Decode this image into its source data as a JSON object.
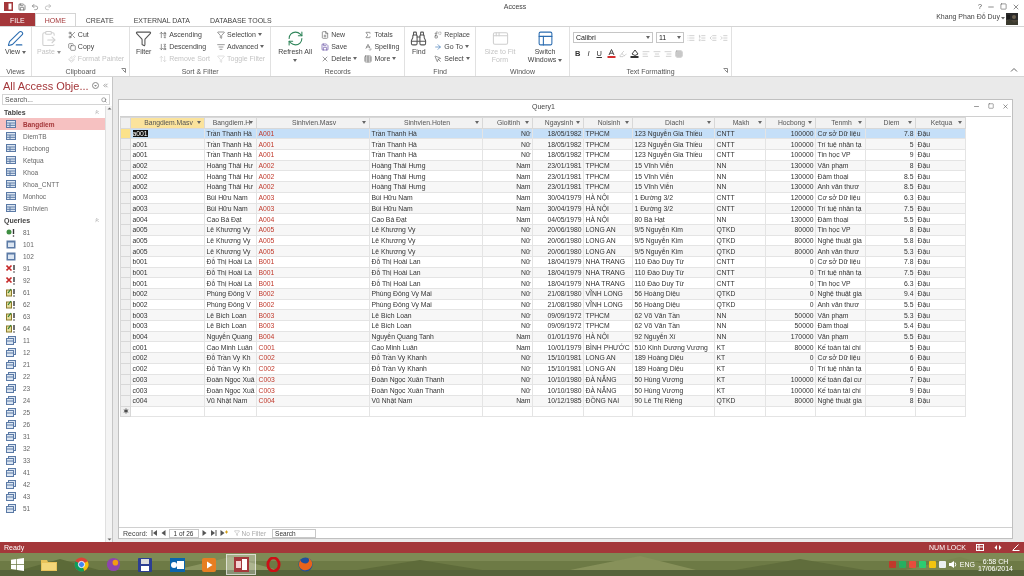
{
  "app": {
    "title": "Access",
    "help": "?",
    "user": "Khang Phan Đỗ Duy"
  },
  "ribbon_tabs": [
    {
      "label": "FILE",
      "kind": "file",
      "selected": false
    },
    {
      "label": "HOME",
      "kind": "tab",
      "selected": true
    },
    {
      "label": "CREATE",
      "kind": "tab",
      "selected": false
    },
    {
      "label": "EXTERNAL DATA",
      "kind": "tab",
      "selected": false
    },
    {
      "label": "DATABASE TOOLS",
      "kind": "tab",
      "selected": false
    }
  ],
  "ribbon_groups": [
    {
      "label": "Views",
      "buttons": [
        {
          "label": "View",
          "kind": "large",
          "dropdown": true,
          "disabled": false
        }
      ]
    },
    {
      "label": "Clipboard",
      "launcher": true,
      "buttons": [
        {
          "label": "Paste",
          "kind": "large",
          "dropdown": true,
          "disabled": true
        },
        {
          "label": "Cut",
          "kind": "small",
          "disabled": false
        },
        {
          "label": "Copy",
          "kind": "small",
          "disabled": false
        },
        {
          "label": "Format Painter",
          "kind": "small",
          "disabled": true
        }
      ]
    },
    {
      "label": "Sort & Filter",
      "buttons": [
        {
          "label": "Filter",
          "kind": "large",
          "disabled": false
        },
        {
          "label": "Ascending",
          "kind": "small",
          "disabled": false
        },
        {
          "label": "Descending",
          "kind": "small",
          "disabled": false
        },
        {
          "label": "Remove Sort",
          "kind": "small",
          "disabled": true
        },
        {
          "label": "Selection",
          "kind": "small",
          "dropdown": true,
          "disabled": false
        },
        {
          "label": "Advanced",
          "kind": "small",
          "dropdown": true,
          "disabled": false
        },
        {
          "label": "Toggle Filter",
          "kind": "small",
          "disabled": true
        }
      ]
    },
    {
      "label": "Records",
      "buttons": [
        {
          "label": "Refresh All",
          "kind": "large",
          "dropdown": true,
          "disabled": false
        },
        {
          "label": "New",
          "kind": "small",
          "disabled": false
        },
        {
          "label": "Save",
          "kind": "small",
          "disabled": false
        },
        {
          "label": "Delete",
          "kind": "small",
          "dropdown": true,
          "disabled": false
        },
        {
          "label": "Totals",
          "kind": "small",
          "disabled": false
        },
        {
          "label": "Spelling",
          "kind": "small",
          "disabled": false
        },
        {
          "label": "More",
          "kind": "small",
          "dropdown": true,
          "disabled": false
        }
      ]
    },
    {
      "label": "Find",
      "buttons": [
        {
          "label": "Find",
          "kind": "large",
          "disabled": false
        },
        {
          "label": "Replace",
          "kind": "small",
          "disabled": false
        },
        {
          "label": "Go To",
          "kind": "small",
          "dropdown": true,
          "disabled": false
        },
        {
          "label": "Select",
          "kind": "small",
          "dropdown": true,
          "disabled": false
        }
      ]
    },
    {
      "label": "Window",
      "buttons": [
        {
          "label": "Size to Fit Form",
          "kind": "large",
          "disabled": true
        },
        {
          "label": "Switch Windows",
          "kind": "large",
          "dropdown": true,
          "disabled": false
        }
      ]
    },
    {
      "label": "Text Formatting",
      "launcher": true,
      "buttons": [
        {
          "label": "Calibri",
          "kind": "font",
          "dropdown": true
        },
        {
          "label": "11",
          "kind": "size",
          "dropdown": true
        },
        {
          "label": "B",
          "kind": "format"
        },
        {
          "label": "I",
          "kind": "format"
        },
        {
          "label": "U",
          "kind": "format"
        }
      ]
    }
  ],
  "nav": {
    "title": "All Access Obje...",
    "search_placeholder": "Search...",
    "sections": [
      {
        "label": "Tables",
        "items": [
          {
            "label": "Bangdiem",
            "kind": "table",
            "selected": true
          },
          {
            "label": "DiemTB",
            "kind": "table",
            "selected": false
          },
          {
            "label": "Hocbong",
            "kind": "table",
            "selected": false
          },
          {
            "label": "Ketqua",
            "kind": "table",
            "selected": false
          },
          {
            "label": "Khoa",
            "kind": "table",
            "selected": false
          },
          {
            "label": "Khoa_CNTT",
            "kind": "table",
            "selected": false
          },
          {
            "label": "Monhoc",
            "kind": "table",
            "selected": false
          },
          {
            "label": "Sinhvien",
            "kind": "table",
            "selected": false
          }
        ]
      },
      {
        "label": "Queries",
        "items": [
          {
            "label": "81",
            "kind": "crosstab",
            "selected": false
          },
          {
            "label": "101",
            "kind": "maketable",
            "selected": false
          },
          {
            "label": "102",
            "kind": "maketable",
            "selected": false
          },
          {
            "label": "91",
            "kind": "delete",
            "selected": false
          },
          {
            "label": "92",
            "kind": "delete",
            "selected": false
          },
          {
            "label": "61",
            "kind": "update",
            "selected": false
          },
          {
            "label": "62",
            "kind": "update",
            "selected": false
          },
          {
            "label": "63",
            "kind": "update",
            "selected": false
          },
          {
            "label": "64",
            "kind": "update",
            "selected": false
          },
          {
            "label": "11",
            "kind": "select",
            "selected": false
          },
          {
            "label": "12",
            "kind": "select",
            "selected": false
          },
          {
            "label": "21",
            "kind": "select",
            "selected": false
          },
          {
            "label": "22",
            "kind": "select",
            "selected": false
          },
          {
            "label": "23",
            "kind": "select",
            "selected": false
          },
          {
            "label": "24",
            "kind": "select",
            "selected": false
          },
          {
            "label": "25",
            "kind": "select",
            "selected": false
          },
          {
            "label": "26",
            "kind": "select",
            "selected": false
          },
          {
            "label": "31",
            "kind": "select",
            "selected": false
          },
          {
            "label": "32",
            "kind": "select",
            "selected": false
          },
          {
            "label": "33",
            "kind": "select",
            "selected": false
          },
          {
            "label": "41",
            "kind": "select",
            "selected": false
          },
          {
            "label": "42",
            "kind": "select",
            "selected": false
          },
          {
            "label": "43",
            "kind": "select",
            "selected": false
          },
          {
            "label": "51",
            "kind": "select",
            "selected": false
          }
        ]
      }
    ]
  },
  "datasheet": {
    "title": "Query1",
    "columns": [
      {
        "label": "Bangdiem.Masv",
        "selected": true
      },
      {
        "label": "Bangdiem.H",
        "selected": false
      },
      {
        "label": "Sinhvien.Masv",
        "selected": false
      },
      {
        "label": "Sinhvien.Hoten",
        "selected": false
      },
      {
        "label": "Gioitinh",
        "selected": false
      },
      {
        "label": "Ngaysinh",
        "selected": false
      },
      {
        "label": "Noisinh",
        "selected": false
      },
      {
        "label": "Diachi",
        "selected": false
      },
      {
        "label": "Makh",
        "selected": false
      },
      {
        "label": "Hocbong",
        "selected": false
      },
      {
        "label": "Tenmh",
        "selected": false
      },
      {
        "label": "Diem",
        "selected": false
      },
      {
        "label": "Ketqua",
        "selected": false
      }
    ],
    "rows": [
      {
        "selected": true,
        "cells": [
          "a001",
          "Trần Thanh Hà",
          "A001",
          "Trần Thanh Hà",
          "Nữ",
          "18/05/1982",
          "TPHCM",
          "123 Nguyễn Gia Thiều",
          "CNTT",
          "100000",
          "Cơ sở Dữ liệu",
          "7.8",
          "Đậu"
        ]
      },
      {
        "selected": false,
        "cells": [
          "a001",
          "Trần Thanh Hà",
          "A001",
          "Trần Thanh Hà",
          "Nữ",
          "18/05/1982",
          "TPHCM",
          "123 Nguyễn Gia Thiều",
          "CNTT",
          "100000",
          "Trí tuệ nhân tạ",
          "5",
          "Đậu"
        ]
      },
      {
        "selected": false,
        "cells": [
          "a001",
          "Trần Thanh Hà",
          "A001",
          "Trần Thanh Hà",
          "Nữ",
          "18/05/1982",
          "TPHCM",
          "123 Nguyễn Gia Thiều",
          "CNTT",
          "100000",
          "Tin học VP",
          "9",
          "Đậu"
        ]
      },
      {
        "selected": false,
        "cells": [
          "a002",
          "Hoàng Thái Hư",
          "A002",
          "Hoàng Thái Hưng",
          "Nam",
          "23/01/1981",
          "TPHCM",
          "15 Vĩnh Viễn",
          "NN",
          "130000",
          "Văn phạm",
          "8",
          "Đậu"
        ]
      },
      {
        "selected": false,
        "cells": [
          "a002",
          "Hoàng Thái Hư",
          "A002",
          "Hoàng Thái Hưng",
          "Nam",
          "23/01/1981",
          "TPHCM",
          "15 Vĩnh Viễn",
          "NN",
          "130000",
          "Đàm thoại",
          "8.5",
          "Đậu"
        ]
      },
      {
        "selected": false,
        "cells": [
          "a002",
          "Hoàng Thái Hư",
          "A002",
          "Hoàng Thái Hưng",
          "Nam",
          "23/01/1981",
          "TPHCM",
          "15 Vĩnh Viễn",
          "NN",
          "130000",
          "Anh văn thươ",
          "8.5",
          "Đậu"
        ]
      },
      {
        "selected": false,
        "cells": [
          "a003",
          "Bùi Hữu Nam",
          "A003",
          "Bùi Hữu Nam",
          "Nam",
          "30/04/1979",
          "HÀ NỘI",
          "1 Đường 3/2",
          "CNTT",
          "120000",
          "Cơ sở Dữ liệu",
          "6.3",
          "Đậu"
        ]
      },
      {
        "selected": false,
        "cells": [
          "a003",
          "Bùi Hữu Nam",
          "A003",
          "Bùi Hữu Nam",
          "Nam",
          "30/04/1979",
          "HÀ NỘI",
          "1 Đường 3/2",
          "CNTT",
          "120000",
          "Trí tuệ nhân tạ",
          "7.5",
          "Đậu"
        ]
      },
      {
        "selected": false,
        "cells": [
          "a004",
          "Cao Bá Đạt",
          "A004",
          "Cao Bá Đạt",
          "Nam",
          "04/05/1979",
          "HÀ NỘI",
          "80 Bà Hạt",
          "NN",
          "130000",
          "Đàm thoại",
          "5.5",
          "Đậu"
        ]
      },
      {
        "selected": false,
        "cells": [
          "a005",
          "Lê Khương Vy",
          "A005",
          "Lê Khương Vy",
          "Nữ",
          "20/06/1980",
          "LONG AN",
          "9/5 Nguyễn Kim",
          "QTKD",
          "80000",
          "Tin học VP",
          "8",
          "Đậu"
        ]
      },
      {
        "selected": false,
        "cells": [
          "a005",
          "Lê Khương Vy",
          "A005",
          "Lê Khương Vy",
          "Nữ",
          "20/06/1980",
          "LONG AN",
          "9/5 Nguyễn Kim",
          "QTKD",
          "80000",
          "Nghệ thuật gia",
          "5.8",
          "Đậu"
        ]
      },
      {
        "selected": false,
        "cells": [
          "a005",
          "Lê Khương Vy",
          "A005",
          "Lê Khương Vy",
          "Nữ",
          "20/06/1980",
          "LONG AN",
          "9/5 Nguyễn Kim",
          "QTKD",
          "80000",
          "Anh văn thươ",
          "5.3",
          "Đậu"
        ]
      },
      {
        "selected": false,
        "cells": [
          "b001",
          "Đỗ Thị Hoài La",
          "B001",
          "Đỗ Thị Hoài Lan",
          "Nữ",
          "18/04/1979",
          "NHA TRANG",
          "110 Đào Duy Từ",
          "CNTT",
          "0",
          "Cơ sở Dữ liệu",
          "7.8",
          "Đậu"
        ]
      },
      {
        "selected": false,
        "cells": [
          "b001",
          "Đỗ Thị Hoài La",
          "B001",
          "Đỗ Thị Hoài Lan",
          "Nữ",
          "18/04/1979",
          "NHA TRANG",
          "110 Đào Duy Từ",
          "CNTT",
          "0",
          "Trí tuệ nhân tạ",
          "7.5",
          "Đậu"
        ]
      },
      {
        "selected": false,
        "cells": [
          "b001",
          "Đỗ Thị Hoài La",
          "B001",
          "Đỗ Thị Hoài Lan",
          "Nữ",
          "18/04/1979",
          "NHA TRANG",
          "110 Đào Duy Từ",
          "CNTT",
          "0",
          "Tin học VP",
          "6.3",
          "Đậu"
        ]
      },
      {
        "selected": false,
        "cells": [
          "b002",
          "Phùng Đông V",
          "B002",
          "Phùng Đông Vy Mai",
          "Nữ",
          "21/08/1980",
          "VĨNH LONG",
          "56 Hoàng Diệu",
          "QTKD",
          "0",
          "Nghệ thuật gia",
          "9.4",
          "Đậu"
        ]
      },
      {
        "selected": false,
        "cells": [
          "b002",
          "Phùng Đông V",
          "B002",
          "Phùng Đông Vy Mai",
          "Nữ",
          "21/08/1980",
          "VĨNH LONG",
          "56 Hoàng Diệu",
          "QTKD",
          "0",
          "Anh văn thươ",
          "5.5",
          "Đậu"
        ]
      },
      {
        "selected": false,
        "cells": [
          "b003",
          "Lê Bích Loan",
          "B003",
          "Lê Bích Loan",
          "Nữ",
          "09/09/1972",
          "TPHCM",
          "62 Võ Văn Tần",
          "NN",
          "50000",
          "Văn phạm",
          "5.3",
          "Đậu"
        ]
      },
      {
        "selected": false,
        "cells": [
          "b003",
          "Lê Bích Loan",
          "B003",
          "Lê Bích Loan",
          "Nữ",
          "09/09/1972",
          "TPHCM",
          "62 Võ Văn Tần",
          "NN",
          "50000",
          "Đàm thoại",
          "5.4",
          "Đậu"
        ]
      },
      {
        "selected": false,
        "cells": [
          "b004",
          "Nguyễn Quang",
          "B004",
          "Nguyễn Quang Tanh",
          "Nam",
          "01/01/1976",
          "HÀ NỘI",
          "92 Nguyễn Xí",
          "NN",
          "170000",
          "Văn phạm",
          "5.5",
          "Đậu"
        ]
      },
      {
        "selected": false,
        "cells": [
          "c001",
          "Cao Minh Luân",
          "C001",
          "Cao Minh Luân",
          "Nam",
          "10/01/1979",
          "BÌNH PHƯỚC",
          "510 Kinh Dương Vương",
          "KT",
          "80000",
          "Kế toán tài chí",
          "5",
          "Đậu"
        ]
      },
      {
        "selected": false,
        "cells": [
          "c002",
          "Đỗ Trần Vy Kh",
          "C002",
          "Đỗ Trần Vy Khanh",
          "Nữ",
          "15/10/1981",
          "LONG AN",
          "189 Hoàng Diệu",
          "KT",
          "0",
          "Cơ sở Dữ liệu",
          "6",
          "Đậu"
        ]
      },
      {
        "selected": false,
        "cells": [
          "c002",
          "Đỗ Trần Vy Kh",
          "C002",
          "Đỗ Trần Vy Khanh",
          "Nữ",
          "15/10/1981",
          "LONG AN",
          "189 Hoàng Diệu",
          "KT",
          "0",
          "Trí tuệ nhân tạ",
          "6",
          "Đậu"
        ]
      },
      {
        "selected": false,
        "cells": [
          "c003",
          "Đoàn Ngọc Xuâ",
          "C003",
          "Đoàn Ngọc Xuân Thanh",
          "Nữ",
          "10/10/1980",
          "ĐÀ NẴNG",
          "50 Hùng Vương",
          "KT",
          "100000",
          "Kế toán đại cư",
          "7",
          "Đậu"
        ]
      },
      {
        "selected": false,
        "cells": [
          "c003",
          "Đoàn Ngọc Xuâ",
          "C003",
          "Đoàn Ngọc Xuân Thanh",
          "Nữ",
          "10/10/1980",
          "ĐÀ NẴNG",
          "50 Hùng Vương",
          "KT",
          "100000",
          "Kế toán tài chí",
          "9",
          "Đậu"
        ]
      },
      {
        "selected": false,
        "cells": [
          "c004",
          "Vũ Nhật Nam",
          "C004",
          "Vũ Nhật Nam",
          "Nam",
          "10/12/1985",
          "ĐỒNG NAI",
          "90 Lê Thị Riêng",
          "QTKD",
          "80000",
          "Nghệ thuật gia",
          "8",
          "Đậu"
        ]
      }
    ],
    "record_nav": {
      "label": "Record:",
      "position": "1 of 26",
      "filter": "No Filter",
      "search_placeholder": "Search"
    }
  },
  "status_bar": {
    "text": "Ready",
    "indicator": "NUM LOCK"
  },
  "taskbar": {
    "apps": [
      {
        "selected": false
      },
      {
        "selected": false
      },
      {
        "selected": false
      },
      {
        "selected": false
      },
      {
        "selected": false
      },
      {
        "selected": false
      },
      {
        "selected": true
      },
      {
        "selected": false
      },
      {
        "selected": false
      }
    ],
    "language": "ENG",
    "time": "6:58 CH",
    "date": "17/06/2014"
  }
}
